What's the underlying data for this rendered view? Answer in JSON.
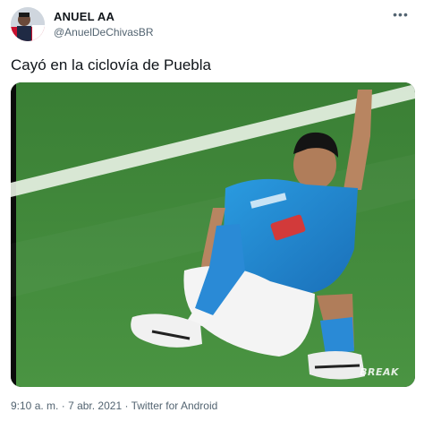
{
  "author": {
    "name": "ANUEL AA",
    "handle": "@AnuelDeChivasBR",
    "avatar_icon": "profile-photo"
  },
  "tweet": {
    "text": "Cayó en la ciclovía de Puebla",
    "more_icon": "more-options-icon",
    "media": {
      "description_icon": "soccer-player-image",
      "watermark": "BREAK"
    }
  },
  "meta": {
    "time": "9:10 a. m.",
    "separator": "·",
    "date": "7 abr. 2021",
    "source": "Twitter for Android"
  },
  "colors": {
    "text": "#0f1419",
    "secondary": "#536471",
    "pitch": "#3f8a3a",
    "jersey": "#1f8ad6"
  }
}
